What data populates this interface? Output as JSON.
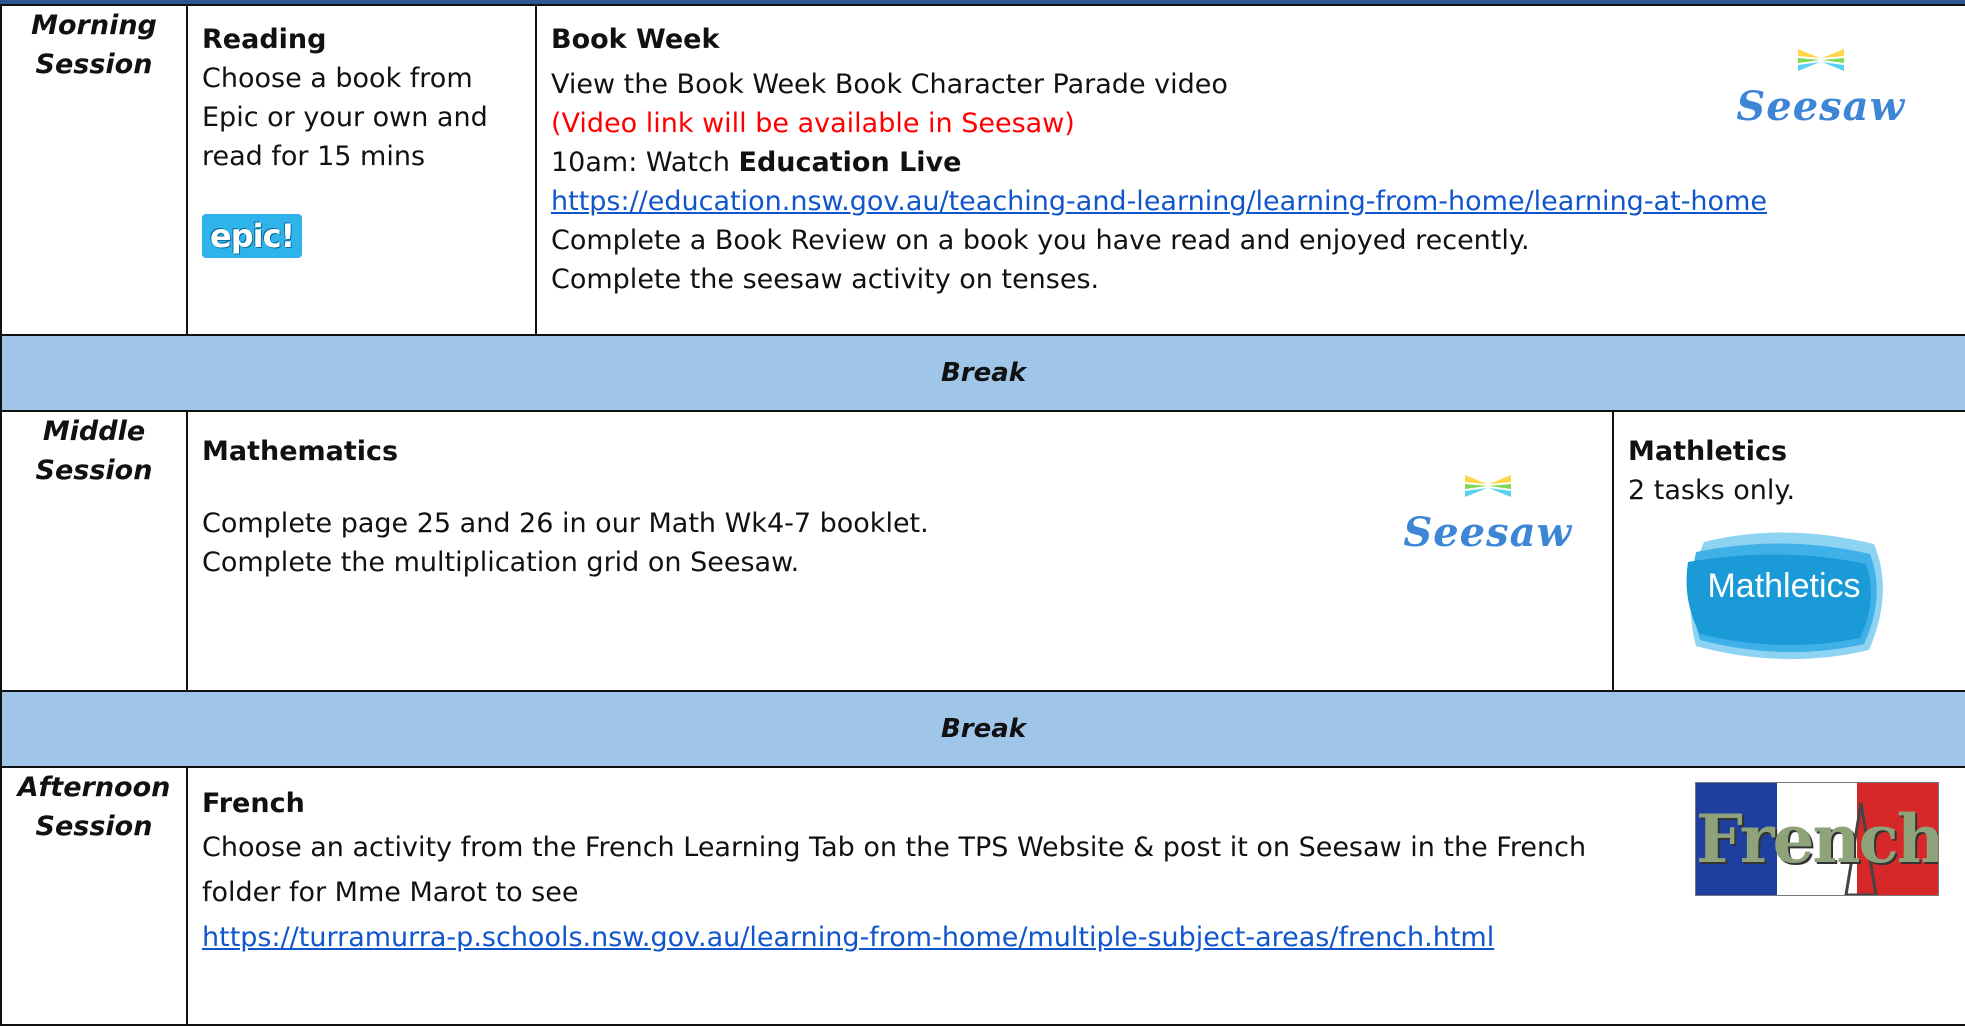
{
  "morning": {
    "session_label": "Morning Session",
    "reading": {
      "title": "Reading",
      "lines": [
        "Choose a book from",
        "Epic or your own and",
        "read for 15 mins"
      ],
      "logo_text": "epic!"
    },
    "book_week": {
      "title": "Book Week",
      "line1": "View the Book Week Book Character Parade video",
      "line2_red": "(Video link will be available in Seesaw)",
      "line3_prefix": "10am: Watch ",
      "line3_bold": "Education Live",
      "link": "https://education.nsw.gov.au/teaching-and-learning/learning-from-home/learning-at-home",
      "line5": "Complete a Book Review on a book you have read and enjoyed recently.",
      "line6": "Complete the seesaw activity on tenses.",
      "logo_text": "Seesaw"
    }
  },
  "break1": "Break",
  "middle": {
    "session_label": "Middle Session",
    "mathematics": {
      "title": "Mathematics",
      "line1": "Complete page 25 and 26 in our Math Wk4-7 booklet.",
      "line2": "Complete the multiplication grid on Seesaw.",
      "logo_text": "Seesaw"
    },
    "mathletics": {
      "title": "Mathletics",
      "line1": "2 tasks only.",
      "logo_text": "Mathletics"
    }
  },
  "break2": "Break",
  "afternoon": {
    "session_label": "Afternoon Session",
    "french": {
      "title": "French",
      "line1": "Choose an activity from the French Learning Tab on the TPS Website & post it on Seesaw in the French",
      "line2": "folder for Mme Marot to see",
      "link": "https://turramurra-p.schools.nsw.gov.au/learning-from-home/multiple-subject-areas/french.html",
      "logo_text": "French"
    }
  },
  "colors": {
    "break_fill": "#9fc5e8",
    "link": "#1155cc",
    "notice_red": "#ff0000",
    "seesaw_blue": "#3d86d6",
    "epic_blue": "#2eb3ea",
    "mathletics_blue": "#1a9ad6"
  }
}
